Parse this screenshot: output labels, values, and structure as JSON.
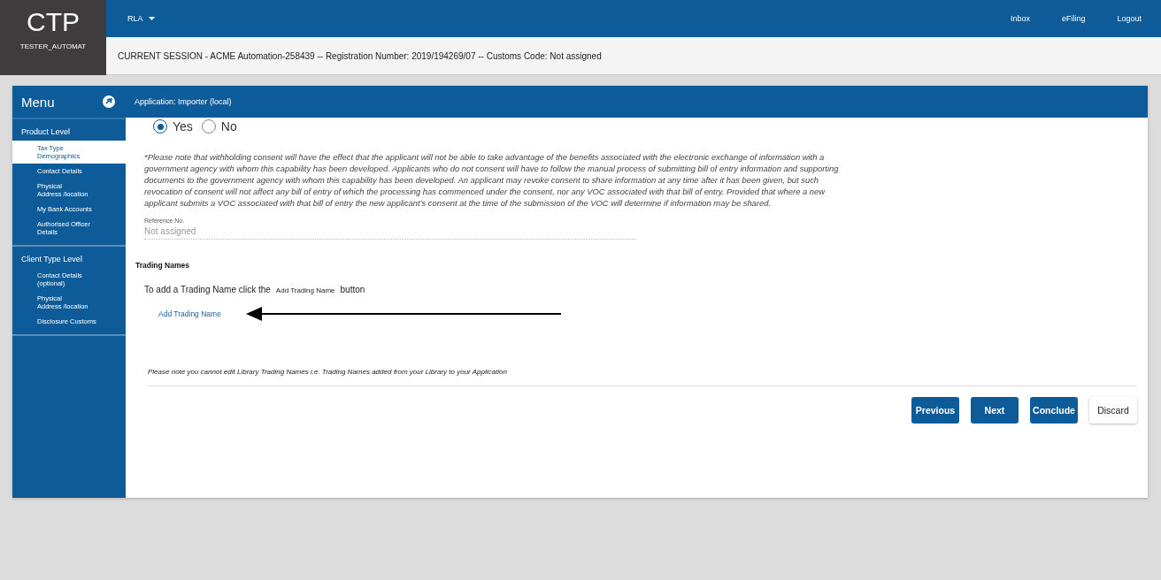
{
  "brand": {
    "logo": "CTP",
    "user": "TESTER_AUTOMAT"
  },
  "top_nav": {
    "dropdown": "RLA",
    "links": [
      "Inbox",
      "eFiling",
      "Logout"
    ]
  },
  "session_bar": "CURRENT SESSION - ACME Automation-258439 -- Registration Number: 2019/194269/07 -- Customs Code: Not assigned",
  "menu": {
    "title": "Menu",
    "sections": [
      {
        "title": "Product Level",
        "items": [
          {
            "label": "Tax Type\nDemographics",
            "selected": true
          },
          {
            "label": "Contact Details",
            "selected": false
          },
          {
            "label": "Physical\nAddress /location",
            "selected": false
          },
          {
            "label": "My Bank Accounts",
            "selected": false
          },
          {
            "label": "Authorised Officer\nDetails",
            "selected": false
          }
        ]
      },
      {
        "title": "Client Type Level",
        "items": [
          {
            "label": "Contact Details\n(optional)",
            "selected": false
          },
          {
            "label": "Physical\nAddress /location",
            "selected": false
          },
          {
            "label": "Disclosure Customs",
            "selected": false
          }
        ]
      }
    ]
  },
  "page_title": "Application: Importer (local)",
  "consent": {
    "options": [
      {
        "label": "Yes",
        "selected": true
      },
      {
        "label": "No",
        "selected": false
      }
    ],
    "note": "*Please note that withholding consent will have the effect that the applicant will not be able to take advantage of the benefits associated with the electronic exchange of information with a government agency with whom this capability has been developed. Applicants who do not consent will have to follow the manual process of submitting bill of entry information and supporting documents to the government agency with whom this capability has been developed. An applicant may revoke consent to share information at any time after it has been given, but such revocation of consent will not affect any bill of entry of which the processing has commenced under the consent, nor any VOC associated with that bill of entry. Provided that where a new applicant submits a VOC associated with that bill of entry the new applicant’s consent at the time of the submission of the VOC will determine if information may be shared."
  },
  "reference": {
    "label": "Reference No.",
    "value": "Not assigned"
  },
  "trading_names": {
    "title": "Trading Names",
    "instruction_before": "To add a Trading Name click the",
    "instruction_button": "Add Trading Name",
    "instruction_after": "button",
    "add_link": "Add Trading Name",
    "footnote": "Please note  you cannot edit Library Trading Names i.e. Trading Names added from your Library to your Application"
  },
  "buttons": [
    {
      "label": "Previous",
      "kind": "primary"
    },
    {
      "label": "Next",
      "kind": "primary"
    },
    {
      "label": "Conclude",
      "kind": "primary"
    },
    {
      "label": "Discard",
      "kind": "secondary"
    }
  ]
}
